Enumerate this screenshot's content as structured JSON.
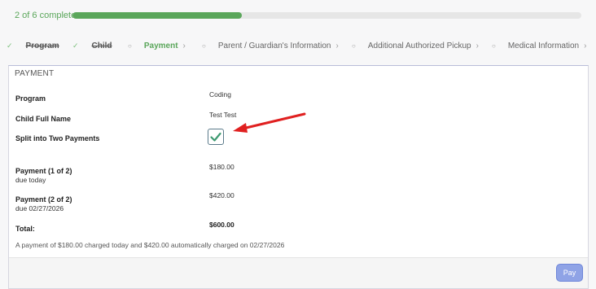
{
  "progress": {
    "text": "2 of 6 complete",
    "completed_steps": 2,
    "total_steps": 6,
    "fraction": 0.3333,
    "color": "#5aa65a"
  },
  "steps": [
    {
      "label": "Program",
      "state": "completed"
    },
    {
      "label": "Child",
      "state": "completed"
    },
    {
      "label": "Payment",
      "state": "active"
    },
    {
      "label": "Parent / Guardian's Information",
      "state": "pending"
    },
    {
      "label": "Additional Authorized Pickup",
      "state": "pending"
    },
    {
      "label": "Medical Information",
      "state": "pending"
    }
  ],
  "payment": {
    "title": "PAYMENT",
    "program_label": "Program",
    "program_value": "Coding",
    "child_label": "Child Full Name",
    "child_value": "Test Test",
    "split_label": "Split into Two Payments",
    "split_checked": true,
    "payment1_label": "Payment (1 of 2)",
    "payment1_sub": "due today",
    "payment1_value": "$180.00",
    "payment2_label": "Payment (2 of 2)",
    "payment2_sub": "due 02/27/2026",
    "payment2_value": "$420.00",
    "total_label": "Total:",
    "total_value": "$600.00",
    "note": "A payment of $180.00 charged today and $420.00 automatically charged on 02/27/2026"
  },
  "footer": {
    "pay_label": "Pay"
  },
  "colors": {
    "accent_green": "#5aa65a",
    "pay_button": "#8fa3e6",
    "annotation_arrow": "#e02020",
    "checkmark": "#3d9970"
  }
}
